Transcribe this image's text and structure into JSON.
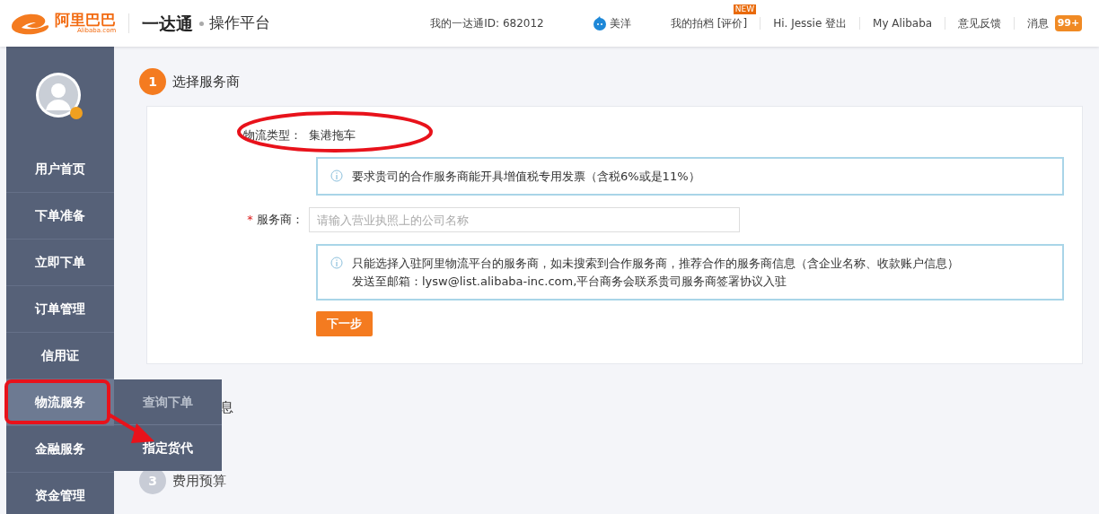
{
  "header": {
    "logo": {
      "name": "阿里巴巴",
      "domain": "Alibaba.com"
    },
    "product": "一达通",
    "platform": "操作平台",
    "nav": [
      {
        "kind": "text",
        "text": "我的一达通ID: 682012"
      },
      {
        "kind": "user",
        "text": "美洋"
      },
      {
        "kind": "text",
        "text": "我的拍档 [评价]",
        "badge": "NEW"
      },
      {
        "kind": "text",
        "text": "Hi. Jessie 登出"
      },
      {
        "kind": "text",
        "text": "My Alibaba"
      },
      {
        "kind": "text",
        "text": "意见反馈"
      },
      {
        "kind": "count",
        "text": "消息",
        "badge": "99+"
      }
    ]
  },
  "sidebar": {
    "items": [
      {
        "label": "用户首页",
        "selected": false
      },
      {
        "label": "下单准备",
        "selected": false
      },
      {
        "label": "立即下单",
        "selected": false
      },
      {
        "label": "订单管理",
        "selected": false
      },
      {
        "label": "信用证",
        "selected": false
      },
      {
        "label": "物流服务",
        "selected": true
      },
      {
        "label": "金融服务",
        "selected": false
      },
      {
        "label": "资金管理",
        "selected": false
      }
    ],
    "submenu": [
      {
        "label": "查询下单",
        "selected": false
      },
      {
        "label": "指定货代",
        "selected": true
      }
    ]
  },
  "steps": [
    {
      "number": "1",
      "label": "选择服务商",
      "active": true
    },
    {
      "label": "息"
    },
    {
      "number": "3",
      "label": "费用预算",
      "active": false
    }
  ],
  "form": {
    "type_label": "物流类型：",
    "type_value": "集港拖车",
    "notice_1": "要求贵司的合作服务商能开具增值税专用发票（含税6%或是11%）",
    "provider_required": "*",
    "provider_label": "服务商：",
    "provider_placeholder": "请输入营业执照上的公司名称",
    "notice_2": [
      "只能选择入驻阿里物流平台的服务商，如未搜索到合作服务商，推荐合作的服务商信息（含企业名称、收款账户信息）",
      "发送至邮箱：lysw@list.alibaba-inc.com,平台商务会联系贵司服务商签署协议入驻"
    ],
    "next_button": "下一步"
  }
}
